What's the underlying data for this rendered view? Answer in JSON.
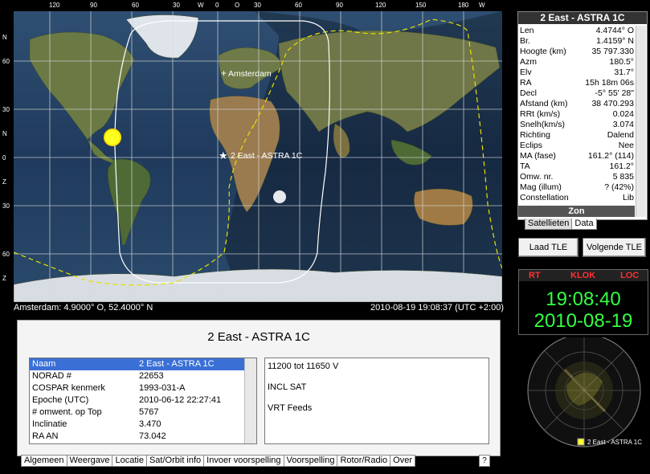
{
  "map": {
    "top_ticks": [
      "120",
      "90",
      "60",
      "30",
      "W",
      "0",
      "O",
      "30",
      "60",
      "90",
      "120",
      "150",
      "180",
      "W"
    ],
    "left_ticks": [
      "N",
      "60",
      "30",
      "N",
      "0",
      "Z",
      "30",
      "60",
      "Z"
    ],
    "labels": {
      "amsterdam": "Amsterdam",
      "satellite": "2 East - ASTRA 1C"
    },
    "status_left": "Amsterdam: 4.9000° O, 52.4000° N",
    "status_right": "2010-08-19 19:08:37 (UTC +2:00)"
  },
  "sat_panel": {
    "title": "2 East - ASTRA 1C",
    "rows": [
      {
        "k": "Len",
        "v": "4.4744° O"
      },
      {
        "k": "Br.",
        "v": "1.4159° N"
      },
      {
        "k": "Hoogte (km)",
        "v": "35 797.330"
      },
      {
        "k": "Azm",
        "v": "180.5°"
      },
      {
        "k": "Elv",
        "v": "31.7°"
      },
      {
        "k": "RA",
        "v": "15h 18m 06s"
      },
      {
        "k": "Decl",
        "v": "-5° 55' 28\""
      },
      {
        "k": "Afstand (km)",
        "v": "38 470.293"
      },
      {
        "k": "RRt (km/s)",
        "v": "0.024"
      },
      {
        "k": "Snelh(km/s)",
        "v": "3.074"
      },
      {
        "k": "Richting",
        "v": "Dalend"
      },
      {
        "k": "Eclips",
        "v": "Nee"
      },
      {
        "k": "MA (fase)",
        "v": "161.2° (114)"
      },
      {
        "k": "TA",
        "v": "161.2°"
      },
      {
        "k": "Omw. nr.",
        "v": "5 835"
      },
      {
        "k": "Mag (illum)",
        "v": "? (42%)"
      },
      {
        "k": "Constellation",
        "v": "Lib"
      }
    ],
    "sun_label": "Zon",
    "tabs": [
      "Satellieten",
      "Data"
    ]
  },
  "buttons": {
    "load_tle": "Laad TLE",
    "next_tle": "Volgende TLE"
  },
  "clock": {
    "rt": "RT",
    "klok": "KLOK",
    "loc": "LOC",
    "time": "19:08:40",
    "date": "2010-08-19"
  },
  "radar": {
    "label": "2 East - ASTRA 1C"
  },
  "info": {
    "title": "2 East - ASTRA 1C",
    "rows": [
      {
        "k": "Naam",
        "v": "2 East - ASTRA 1C"
      },
      {
        "k": "NORAD #",
        "v": "22653"
      },
      {
        "k": "COSPAR kenmerk",
        "v": "1993-031-A"
      },
      {
        "k": "Epoche (UTC)",
        "v": "2010-06-12 22:27:41"
      },
      {
        "k": "# omwent. op Top",
        "v": "5767"
      },
      {
        "k": "Inclinatie",
        "v": "3.470"
      },
      {
        "k": "RA AN",
        "v": "73.042"
      }
    ],
    "notes": [
      "11200   tot   11650   V",
      "INCL SAT",
      "VRT Feeds"
    ]
  },
  "bottom_tabs": [
    "Algemeen",
    "Weergave",
    "Locatie",
    "Sat/Orbit info",
    "Invoer voorspelling",
    "Voorspelling",
    "Rotor/Radio",
    "Over"
  ],
  "help": "?"
}
